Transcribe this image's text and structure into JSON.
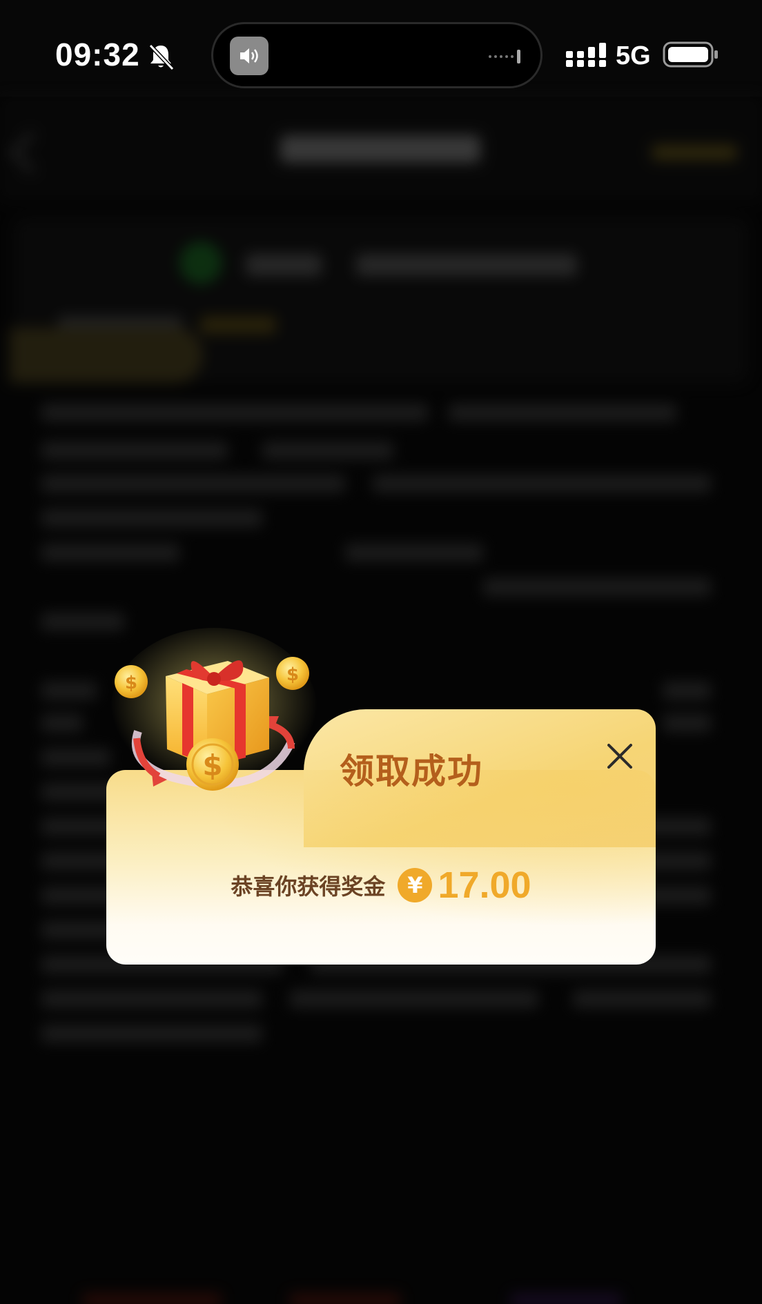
{
  "status_bar": {
    "time": "09:32",
    "network": "5G",
    "icons": [
      "bell-slash-icon",
      "speaker-icon",
      "signal-icon",
      "battery-icon"
    ]
  },
  "dialog": {
    "title": "领取成功",
    "reward_label": "恭喜你获得奖金",
    "currency_symbol": "¥",
    "amount": "17.00"
  },
  "colors": {
    "title": "#b45f1c",
    "amount": "#f0a92a",
    "reward_label": "#6b4324",
    "dialog_top": "#f8dc8a",
    "dialog_bottom": "#fffdf8"
  }
}
